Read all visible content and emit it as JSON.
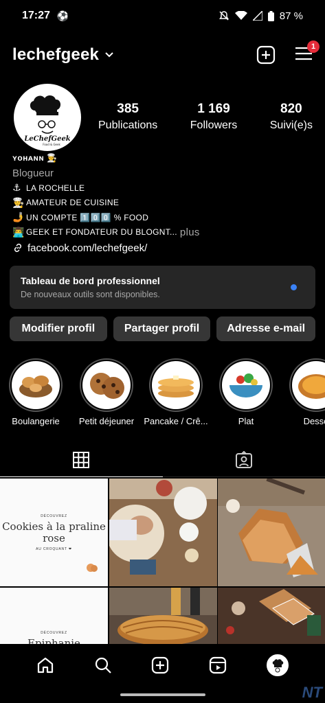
{
  "status": {
    "time": "17:27",
    "battery": "87 %"
  },
  "header": {
    "username": "lechefgeek",
    "notif_count": "1"
  },
  "profile": {
    "stats": [
      {
        "value": "385",
        "label": "Publications"
      },
      {
        "value": "1 169",
        "label": "Followers"
      },
      {
        "value": "820",
        "label": "Suivi(e)s"
      }
    ]
  },
  "bio": {
    "name": "ʏᴏʜᴀɴɴ 👨‍🍳",
    "category": "Blogueur",
    "lines": [
      {
        "icon": "⚓",
        "text": "LA ROCHELLE"
      },
      {
        "icon": "👨‍🍳",
        "text": "AMATEUR DE CUISINE"
      },
      {
        "icon": "🤳",
        "text": "UN COMPTE 1️⃣0️⃣0️⃣ % FOOD"
      },
      {
        "icon": "👨‍💻",
        "text": "GEEK ET FONDATEUR DU BLOGNT..."
      }
    ],
    "more": "plus",
    "link": "facebook.com/lechefgeek/"
  },
  "dashboard": {
    "title": "Tableau de bord professionnel",
    "subtitle": "De nouveaux outils sont disponibles."
  },
  "buttons": {
    "edit": "Modifier profil",
    "share": "Partager profil",
    "email": "Adresse e-mail"
  },
  "highlights": [
    {
      "label": "Boulangerie"
    },
    {
      "label": "Petit déjeuner"
    },
    {
      "label": "Pancake / Crê..."
    },
    {
      "label": "Plat"
    },
    {
      "label": "Desse"
    }
  ],
  "posts": {
    "post1": {
      "top": "DÉCOUVREZ",
      "title": "Cookies à la praline rose",
      "sub": "AU CROQUANT ❤"
    },
    "post4": {
      "top": "DÉCOUVREZ",
      "title": "Epiphanie"
    }
  },
  "avatar": {
    "text": "LeChefGeek",
    "sub": "Food & Geek"
  },
  "watermark": "NT",
  "colors": {
    "accent": "#3b82f6",
    "badge": "#e52c3a",
    "button": "#363636",
    "card": "#262626"
  }
}
